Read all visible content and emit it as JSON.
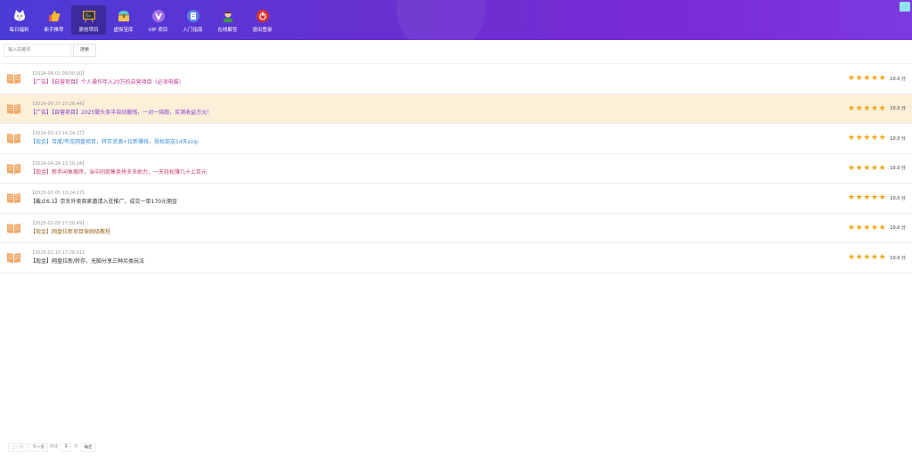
{
  "nav": {
    "items": [
      {
        "label": "每日福利",
        "icon": "cat-face-icon",
        "color": "#f2f2f2",
        "active": false
      },
      {
        "label": "新手推荐",
        "icon": "thumbs-up-icon",
        "color": "#f5b830",
        "active": false
      },
      {
        "label": "原创项目",
        "icon": "blackboard-icon",
        "color": "#3a3a3a",
        "active": true
      },
      {
        "label": "虚拟宝库",
        "icon": "treasure-chest-icon",
        "color": "#5ec6c9",
        "active": false
      },
      {
        "label": "VIP 项目",
        "icon": "vip-icon",
        "color": "#a46be8",
        "active": false
      },
      {
        "label": "入门指南",
        "icon": "guide-book-icon",
        "color": "#5a7ee8",
        "active": false
      },
      {
        "label": "在线解答",
        "icon": "support-person-icon",
        "color": "#3a9a4a",
        "active": false
      },
      {
        "label": "退出登录",
        "icon": "power-off-icon",
        "color": "#d8342a",
        "active": false
      }
    ]
  },
  "search": {
    "placeholder": "输入关键词",
    "button_label": "搜索"
  },
  "list": [
    {
      "date": "【2024-04-01 09:00:00】",
      "title": "【广告】【自营项目】个人操作年入20万的自营项目（必须电脑）",
      "color": "#c2378f",
      "highlight": false,
      "score": "10.0 分",
      "rating": 5
    },
    {
      "date": "【2024-09-27 20:26:44】",
      "title": "【广告】【自营项目】2025做头条半自动搬钱，一对一陪跑，实测收益万元！",
      "color": "#7c3ad8",
      "highlight": true,
      "score": "10.0 分",
      "rating": 5
    },
    {
      "date": "【2024-03-13 14:24:17】",
      "title": "【现金】百度/夸克网盘项目，转存资源+拉新赚钱，授权部送14天svip",
      "color": "#3a8fd8",
      "highlight": false,
      "score": "10.0 分",
      "rating": 5
    },
    {
      "date": "【2024-04-24 23:10:14】",
      "title": "【现金】新手闲鱼搬砖，当中间商售卖拼多多助力，一天轻松赚几十上百元",
      "color": "#c93a6a",
      "highlight": false,
      "score": "10.0 分",
      "rating": 5
    },
    {
      "date": "【2025-02-05 10:24:17】",
      "title": "【截止6.1】京东外卖商家邀请入驻推广，成交一单170元佣金",
      "color": "#333333",
      "highlight": false,
      "score": "10.0 分",
      "rating": 5
    },
    {
      "date": "【2025-02-05 17:50:49】",
      "title": "【现金】网盘拉新项目保姆级教程",
      "color": "#9a6a1e",
      "highlight": false,
      "score": "10.0 分",
      "rating": 5
    },
    {
      "date": "【2025-01-10 17:28:01】",
      "title": "【现金】网盘拉新/转存，无脑分享三种另类玩法",
      "color": "#333333",
      "highlight": false,
      "score": "10.0 分",
      "rating": 5
    }
  ],
  "pager": {
    "prev": "上一页",
    "next": "下一页",
    "goto": "前往",
    "page": "1",
    "unit": "页",
    "confirm": "确定"
  }
}
